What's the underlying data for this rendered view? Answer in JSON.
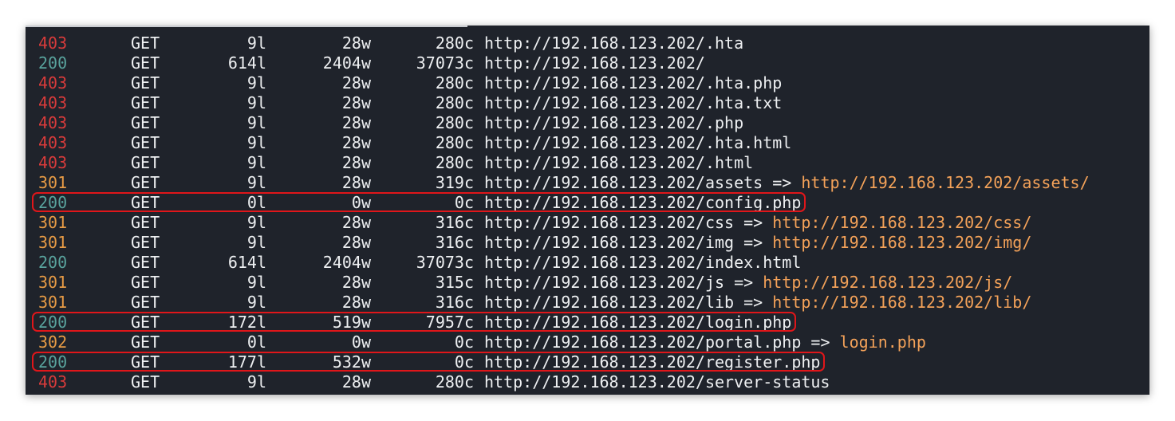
{
  "terminal": {
    "rows": [
      {
        "status": "403",
        "method": "GET",
        "lines": "9l",
        "words": "28w",
        "chars": "280c",
        "url": "http://192.168.123.202/.hta",
        "arrow": "",
        "redirect": "",
        "highlighted": false
      },
      {
        "status": "200",
        "method": "GET",
        "lines": "614l",
        "words": "2404w",
        "chars": "37073c",
        "url": "http://192.168.123.202/",
        "arrow": "",
        "redirect": "",
        "highlighted": false
      },
      {
        "status": "403",
        "method": "GET",
        "lines": "9l",
        "words": "28w",
        "chars": "280c",
        "url": "http://192.168.123.202/.hta.php",
        "arrow": "",
        "redirect": "",
        "highlighted": false
      },
      {
        "status": "403",
        "method": "GET",
        "lines": "9l",
        "words": "28w",
        "chars": "280c",
        "url": "http://192.168.123.202/.hta.txt",
        "arrow": "",
        "redirect": "",
        "highlighted": false
      },
      {
        "status": "403",
        "method": "GET",
        "lines": "9l",
        "words": "28w",
        "chars": "280c",
        "url": "http://192.168.123.202/.php",
        "arrow": "",
        "redirect": "",
        "highlighted": false
      },
      {
        "status": "403",
        "method": "GET",
        "lines": "9l",
        "words": "28w",
        "chars": "280c",
        "url": "http://192.168.123.202/.hta.html",
        "arrow": "",
        "redirect": "",
        "highlighted": false
      },
      {
        "status": "403",
        "method": "GET",
        "lines": "9l",
        "words": "28w",
        "chars": "280c",
        "url": "http://192.168.123.202/.html",
        "arrow": "",
        "redirect": "",
        "highlighted": false
      },
      {
        "status": "301",
        "method": "GET",
        "lines": "9l",
        "words": "28w",
        "chars": "319c",
        "url": "http://192.168.123.202/assets",
        "arrow": "=>",
        "redirect": "http://192.168.123.202/assets/",
        "highlighted": false
      },
      {
        "status": "200",
        "method": "GET",
        "lines": "0l",
        "words": "0w",
        "chars": "0c",
        "url": "http://192.168.123.202/config.php",
        "arrow": "",
        "redirect": "",
        "highlighted": true
      },
      {
        "status": "301",
        "method": "GET",
        "lines": "9l",
        "words": "28w",
        "chars": "316c",
        "url": "http://192.168.123.202/css",
        "arrow": "=>",
        "redirect": "http://192.168.123.202/css/",
        "highlighted": false
      },
      {
        "status": "301",
        "method": "GET",
        "lines": "9l",
        "words": "28w",
        "chars": "316c",
        "url": "http://192.168.123.202/img",
        "arrow": "=>",
        "redirect": "http://192.168.123.202/img/",
        "highlighted": false
      },
      {
        "status": "200",
        "method": "GET",
        "lines": "614l",
        "words": "2404w",
        "chars": "37073c",
        "url": "http://192.168.123.202/index.html",
        "arrow": "",
        "redirect": "",
        "highlighted": false
      },
      {
        "status": "301",
        "method": "GET",
        "lines": "9l",
        "words": "28w",
        "chars": "315c",
        "url": "http://192.168.123.202/js",
        "arrow": "=>",
        "redirect": "http://192.168.123.202/js/",
        "highlighted": false
      },
      {
        "status": "301",
        "method": "GET",
        "lines": "9l",
        "words": "28w",
        "chars": "316c",
        "url": "http://192.168.123.202/lib",
        "arrow": "=>",
        "redirect": "http://192.168.123.202/lib/",
        "highlighted": false
      },
      {
        "status": "200",
        "method": "GET",
        "lines": "172l",
        "words": "519w",
        "chars": "7957c",
        "url": "http://192.168.123.202/login.php",
        "arrow": "",
        "redirect": "",
        "highlighted": true
      },
      {
        "status": "302",
        "method": "GET",
        "lines": "0l",
        "words": "0w",
        "chars": "0c",
        "url": "http://192.168.123.202/portal.php",
        "arrow": "=>",
        "redirect": "login.php",
        "highlighted": false
      },
      {
        "status": "200",
        "method": "GET",
        "lines": "177l",
        "words": "532w",
        "chars": "0c",
        "url": "http://192.168.123.202/register.php",
        "arrow": "",
        "redirect": "",
        "highlighted": true
      },
      {
        "status": "403",
        "method": "GET",
        "lines": "9l",
        "words": "28w",
        "chars": "280c",
        "url": "http://192.168.123.202/server-status",
        "arrow": "",
        "redirect": "",
        "highlighted": false
      }
    ]
  },
  "colors": {
    "background": "#1f232b",
    "text": "#eef0f2",
    "status_403": "#d83b3b",
    "status_200": "#59a39d",
    "status_3xx": "#e79b45",
    "redirect_url": "#f4a259",
    "highlight_box": "#e0161a"
  }
}
